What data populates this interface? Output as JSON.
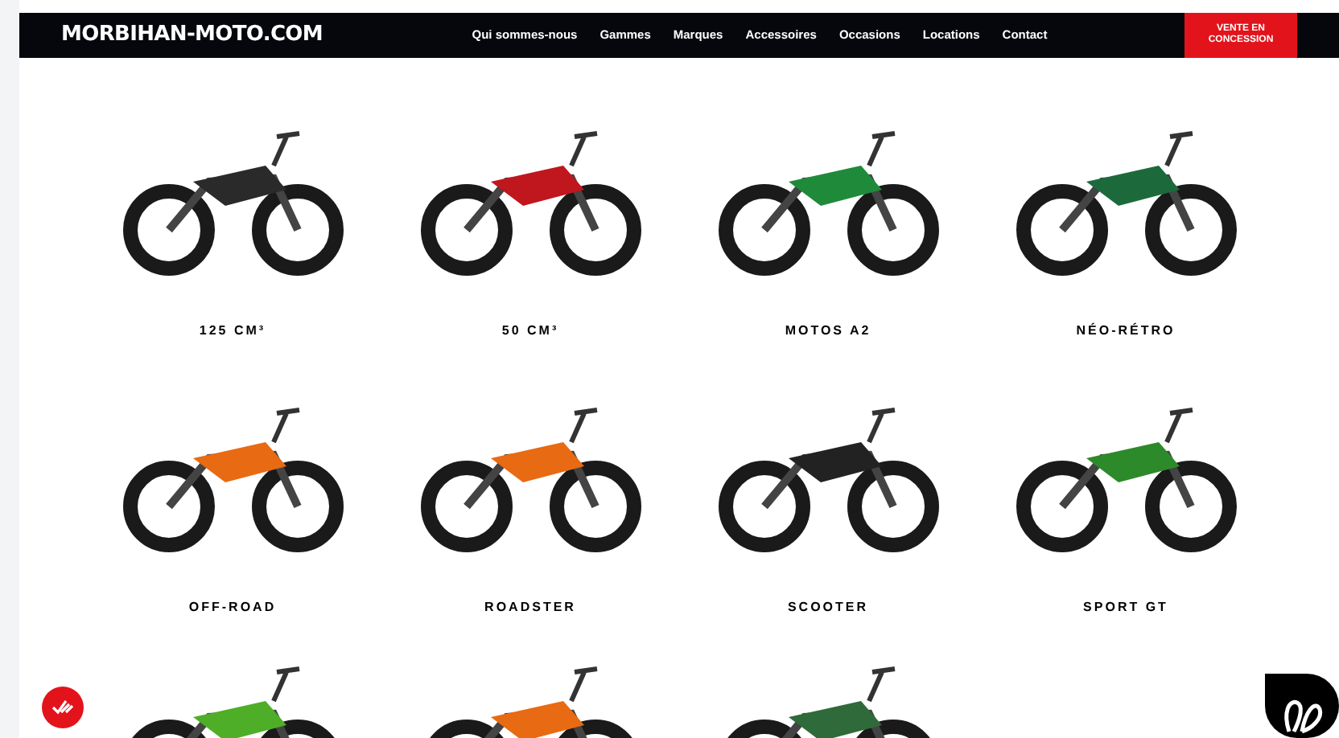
{
  "header": {
    "logo": "MORBIHAN-MOTO.COM",
    "nav": [
      "Qui sommes-nous",
      "Gammes",
      "Marques",
      "Accessoires",
      "Occasions",
      "Locations",
      "Contact"
    ],
    "cta": "VENTE EN CONCESSION"
  },
  "categories": [
    {
      "kind": "labeled",
      "label": "125 CM³"
    },
    {
      "kind": "labeled",
      "label": "50 CM³"
    },
    {
      "kind": "labeled",
      "label": "MOTOS A2"
    },
    {
      "kind": "labeled",
      "label": "NÉO-RÉTRO"
    },
    {
      "kind": "labeled",
      "label": "OFF-ROAD"
    },
    {
      "kind": "labeled",
      "label": "ROADSTER"
    },
    {
      "kind": "labeled",
      "label": "SCOOTER"
    },
    {
      "kind": "labeled",
      "label": "SPORT GT"
    },
    {
      "kind": "cut_off"
    },
    {
      "kind": "cut_off"
    },
    {
      "kind": "cut_off"
    }
  ]
}
